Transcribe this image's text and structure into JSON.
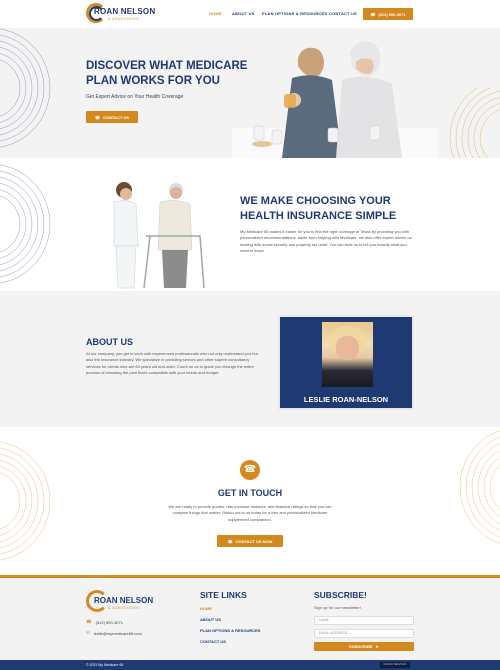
{
  "header": {
    "logo_name": "ROAN NELSON",
    "logo_sub": "& ASSOCIATES",
    "nav": [
      "HOME",
      "ABOUT US",
      "PLAN OPTIONS & RESOURCES",
      "CONTACT US"
    ],
    "phone_button": "(512) 590-3071"
  },
  "hero": {
    "title": "DISCOVER WHAT MEDICARE PLAN WORKS FOR YOU",
    "subtitle": "Get Expert Advice on Your Health Coverage",
    "cta": "CONTACT US"
  },
  "section2": {
    "title": "WE MAKE CHOOSING YOUR HEALTH INSURANCE SIMPLE",
    "body": "My Medicare 65 makes it easier for you to find the right coverage in Texas by providing you with personalized recommendations. Aside from helping with Medicare, we also offer expert advice on dealing with social security and property tax relief. You can trust us to tell you exactly what you need to know."
  },
  "about": {
    "title": "ABOUT US",
    "body": "At our company, you get to work with experienced professionals who not only understand you but also the insurance industry. We specialize in providing seniors and other superb consultancy services for clients who are 64 years old and older. Count on us to guide you through the entire process of choosing the plan that's compatible with your needs and budget.",
    "card_name": "LESLIE ROAN-NELSON"
  },
  "touch": {
    "title": "GET IN TOUCH",
    "body": "We are ready to provide quotes, rate-increase histories, and financial ratings so that you can compare things that matter. Reach out to us today for a free and personalized Medicare supplement comparison.",
    "cta": "CONTACT US NOW"
  },
  "footer": {
    "phone": "(512) 590-3071",
    "email": "leslie@mymedicare65.com",
    "links_title": "SITE LINKS",
    "links": [
      "HOME",
      "ABOUT US",
      "PLAN OPTIONS & RESOURCES",
      "CONTACT US"
    ],
    "subscribe_title": "SUBSCRIBE!",
    "subscribe_text": "Sign up for our newsletter!",
    "name_placeholder": "NAME",
    "email_placeholder": "EMAIL ADDRESS",
    "subscribe_button": "SUBSCRIBE",
    "copyright": "© 2021 My Medicare 65",
    "badge": "DESIGN SERVICES"
  },
  "colors": {
    "navy": "#1f3a73",
    "orange": "#d4891e"
  }
}
